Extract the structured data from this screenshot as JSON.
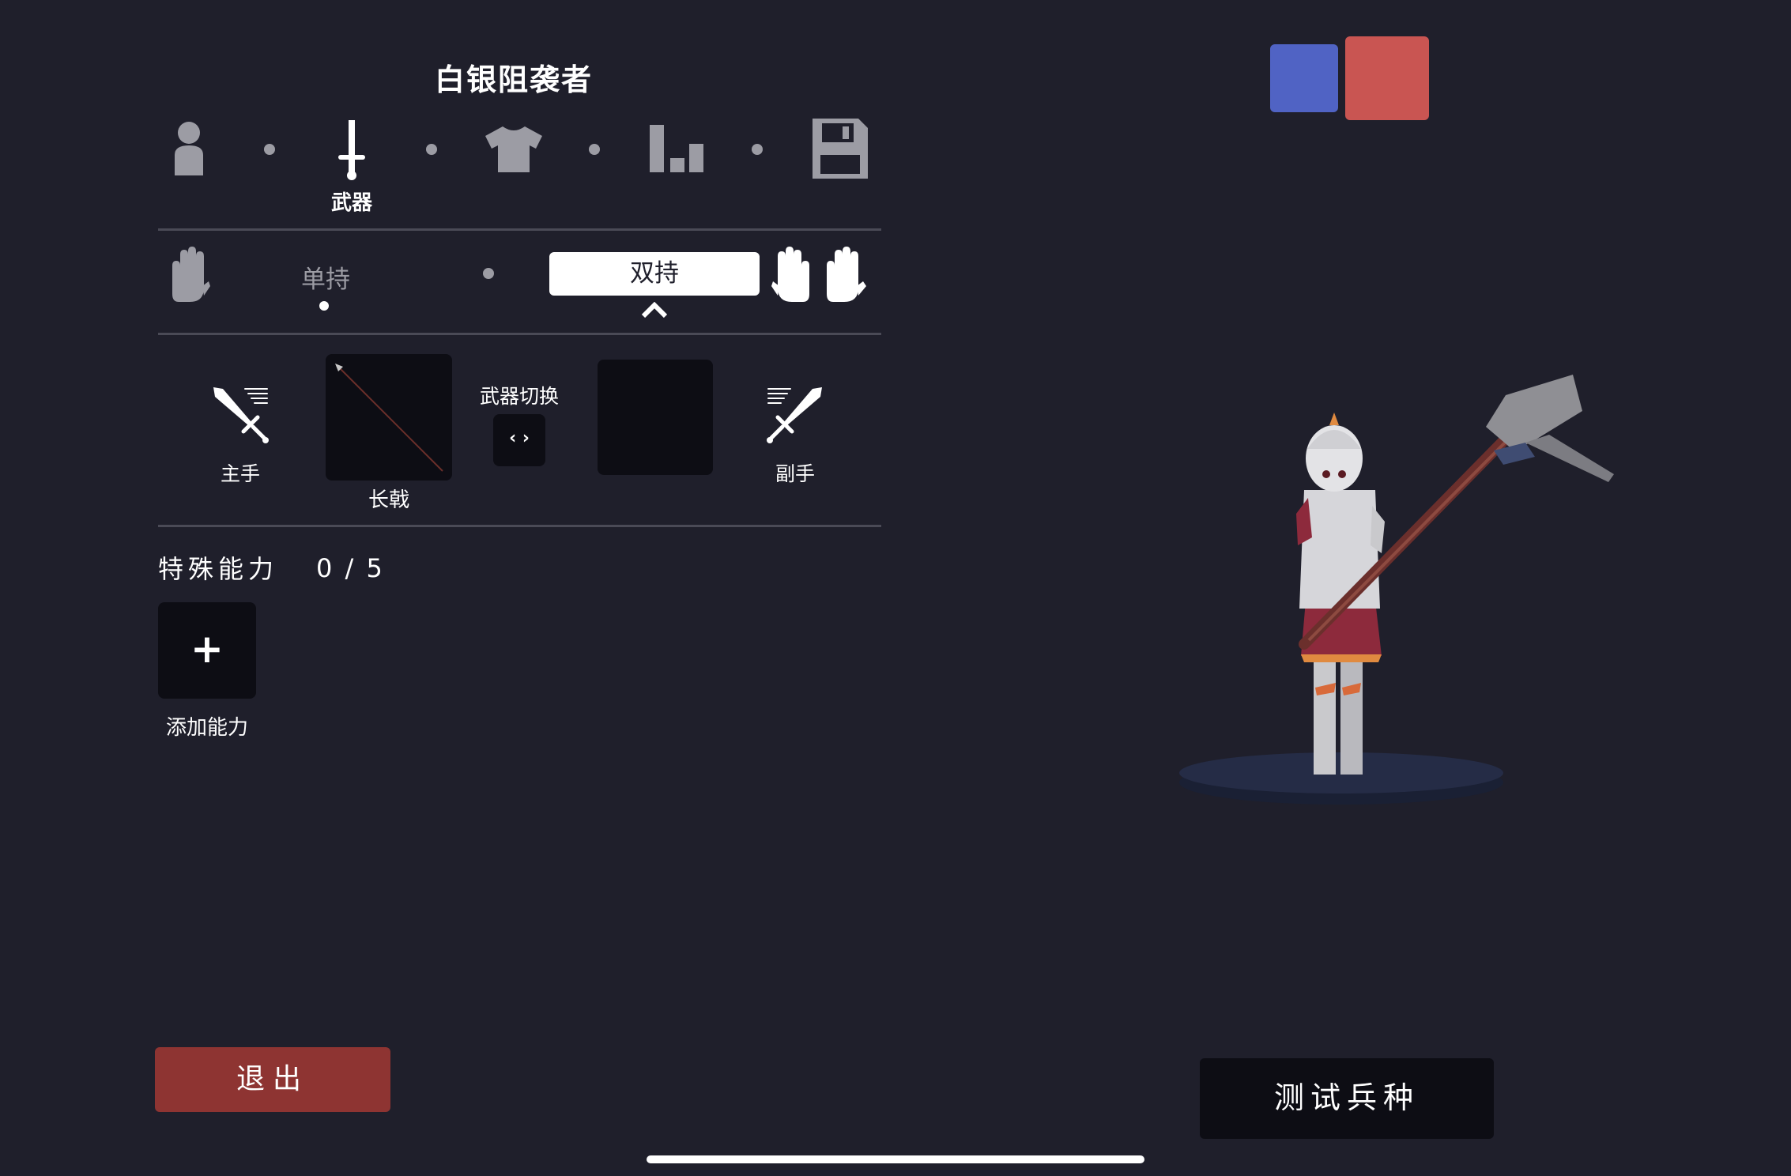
{
  "unit_name": "白银阻袭者",
  "tabs": [
    {
      "icon": "person-icon",
      "label": ""
    },
    {
      "icon": "sword-icon",
      "label": "武器"
    },
    {
      "icon": "shirt-icon",
      "label": ""
    },
    {
      "icon": "stats-icon",
      "label": ""
    },
    {
      "icon": "save-icon",
      "label": ""
    }
  ],
  "grip": {
    "one_handed": "单持",
    "two_handed": "双持"
  },
  "weapons": {
    "main_hand_label": "主手",
    "main_weapon_name": "长戟",
    "switch_label": "武器切换",
    "switch_glyph": "‹ ›",
    "off_hand_label": "副手"
  },
  "abilities": {
    "title": "特殊能力",
    "count": "0 / 5",
    "add_label": "添加能力",
    "add_glyph": "+"
  },
  "team_colors": {
    "blue": "#5063c4",
    "red": "#c95552"
  },
  "buttons": {
    "exit": "退出",
    "test_unit": "测试兵种"
  }
}
